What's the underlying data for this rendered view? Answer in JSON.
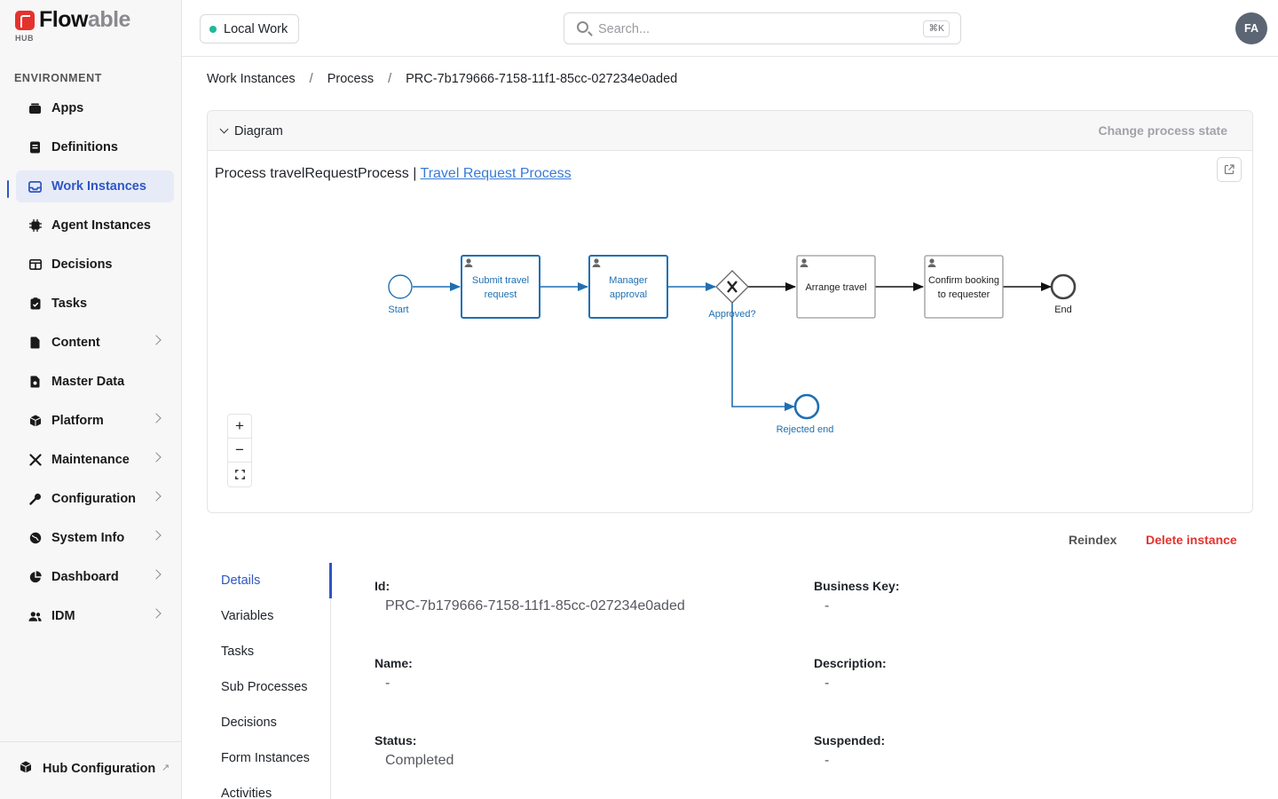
{
  "brand": {
    "name_part1": "Flow",
    "name_part2": "able",
    "sub": "HUB"
  },
  "sidebar": {
    "section_label": "ENVIRONMENT",
    "items": [
      {
        "label": "Apps",
        "icon": "apps-icon",
        "chevron": false,
        "active": false
      },
      {
        "label": "Definitions",
        "icon": "definitions-icon",
        "chevron": false,
        "active": false
      },
      {
        "label": "Work Instances",
        "icon": "inbox-icon",
        "chevron": false,
        "active": true
      },
      {
        "label": "Agent Instances",
        "icon": "chip-icon",
        "chevron": false,
        "active": false
      },
      {
        "label": "Decisions",
        "icon": "table-icon",
        "chevron": false,
        "active": false
      },
      {
        "label": "Tasks",
        "icon": "clipboard-check-icon",
        "chevron": false,
        "active": false
      },
      {
        "label": "Content",
        "icon": "document-icon",
        "chevron": true,
        "active": false
      },
      {
        "label": "Master Data",
        "icon": "master-data-icon",
        "chevron": false,
        "active": false
      },
      {
        "label": "Platform",
        "icon": "cube-icon",
        "chevron": true,
        "active": false
      },
      {
        "label": "Maintenance",
        "icon": "tools-icon",
        "chevron": true,
        "active": false
      },
      {
        "label": "Configuration",
        "icon": "wrench-icon",
        "chevron": true,
        "active": false
      },
      {
        "label": "System Info",
        "icon": "globe-icon",
        "chevron": true,
        "active": false
      },
      {
        "label": "Dashboard",
        "icon": "pie-chart-icon",
        "chevron": true,
        "active": false
      },
      {
        "label": "IDM",
        "icon": "users-icon",
        "chevron": true,
        "active": false
      }
    ],
    "footer": {
      "label": "Hub Configuration",
      "icon": "cube-icon"
    }
  },
  "topbar": {
    "workspace": "Local Work",
    "search_placeholder": "Search...",
    "shortcut": "⌘K",
    "avatar_initials": "FA"
  },
  "breadcrumb": {
    "items": [
      "Work Instances",
      "Process"
    ],
    "current": "PRC-7b179666-7158-11f1-85cc-027234e0aded",
    "separator": "/"
  },
  "diagram": {
    "header_label": "Diagram",
    "change_state_label": "Change process state",
    "title_prefix": "Process travelRequestProcess |",
    "title_link": "Travel Request Process",
    "nodes": {
      "start": "Start",
      "submit_line1": "Submit travel",
      "submit_line2": "request",
      "manager_line1": "Manager",
      "manager_line2": "approval",
      "gateway": "Approved?",
      "arrange": "Arrange travel",
      "confirm_line1": "Confirm booking",
      "confirm_line2": "to requester",
      "end": "End",
      "rejected": "Rejected end"
    },
    "colors": {
      "completed": "#1f6fb2",
      "pending": "#1a1a1a",
      "task_border_pending": "#9a9a9a"
    }
  },
  "actions": {
    "reindex": "Reindex",
    "delete": "Delete instance"
  },
  "tabs": [
    "Details",
    "Variables",
    "Tasks",
    "Sub Processes",
    "Decisions",
    "Form Instances",
    "Activities"
  ],
  "details": {
    "id": {
      "label": "Id:",
      "value": "PRC-7b179666-7158-11f1-85cc-027234e0aded"
    },
    "business_key": {
      "label": "Business Key:",
      "value": "-"
    },
    "name": {
      "label": "Name:",
      "value": "-"
    },
    "description": {
      "label": "Description:",
      "value": "-"
    },
    "status": {
      "label": "Status:",
      "value": "Completed"
    },
    "suspended": {
      "label": "Suspended:",
      "value": "-"
    }
  }
}
